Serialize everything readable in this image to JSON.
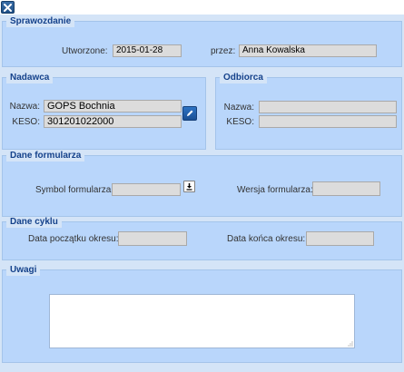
{
  "window": {
    "close_icon": "close-icon"
  },
  "sprawozdanie": {
    "legend": "Sprawozdanie",
    "utworzone_label": "Utworzone:",
    "utworzone_value": "2015-01-28",
    "przez_label": "przez:",
    "przez_value": "Anna Kowalska"
  },
  "nadawca": {
    "legend": "Nadawca",
    "nazwa_label": "Nazwa:",
    "nazwa_value": "GOPS Bochnia",
    "keso_label": "KESO:",
    "keso_value": "301201022000",
    "edit_icon": "pencil-icon"
  },
  "odbiorca": {
    "legend": "Odbiorca",
    "nazwa_label": "Nazwa:",
    "nazwa_value": "",
    "keso_label": "KESO:",
    "keso_value": ""
  },
  "dane_formularza": {
    "legend": "Dane formularza",
    "symbol_label": "Symbol formularza:",
    "symbol_value": "",
    "download_icon": "download-icon",
    "wersja_label": "Wersja formularza:",
    "wersja_value": ""
  },
  "dane_cyklu": {
    "legend": "Dane cyklu",
    "poczatek_label": "Data początku okresu:",
    "poczatek_value": "",
    "koniec_label": "Data końca okresu:",
    "koniec_value": ""
  },
  "uwagi": {
    "legend": "Uwagi",
    "value": ""
  }
}
